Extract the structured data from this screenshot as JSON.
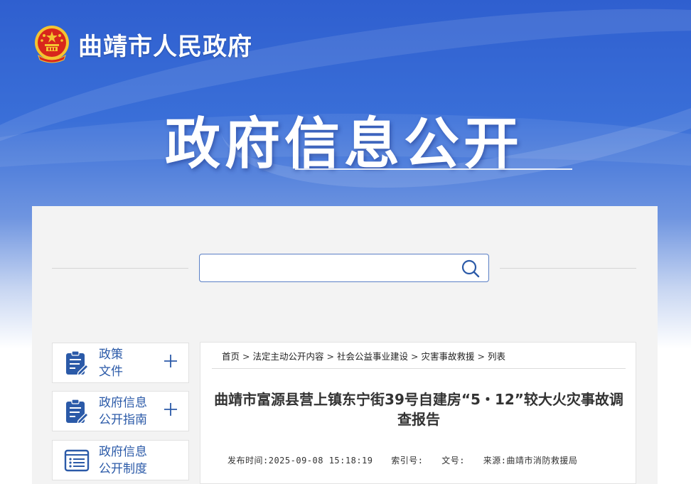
{
  "header": {
    "site_title": "曲靖市人民政府",
    "hero_title": "政府信息公开"
  },
  "search": {
    "value": "",
    "placeholder": ""
  },
  "sidebar": {
    "items": [
      {
        "line1": "政策",
        "line2": "文件",
        "icon": "document-edit-icon"
      },
      {
        "line1": "政府信息",
        "line2": "公开指南",
        "icon": "document-edit-icon"
      },
      {
        "line1": "政府信息",
        "line2": "公开制度",
        "icon": "list-document-icon"
      }
    ]
  },
  "breadcrumb": {
    "items": [
      "首页",
      "法定主动公开内容",
      "社会公益事业建设",
      "灾害事故救援",
      "列表"
    ],
    "separator": ">"
  },
  "article": {
    "title": "曲靖市富源县营上镇东宁街39号自建房“5・12”较大火灾事故调查报告",
    "publish_label": "发布时间:",
    "publish_time": "2025-09-08 15:18:19",
    "index_label": "索引号:",
    "index_value": "",
    "doc_label": "文号:",
    "doc_value": "",
    "source_label": "来源:",
    "source_value": "曲靖市消防救援局"
  },
  "colors": {
    "brand_blue": "#2f5fcf",
    "link_blue": "#2b5aa8",
    "emblem_red": "#d8261c",
    "emblem_gold": "#f4c430"
  }
}
